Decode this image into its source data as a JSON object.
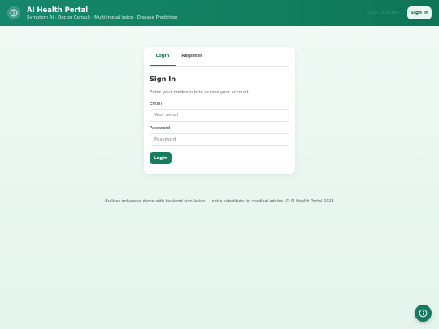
{
  "header": {
    "title": "AI Health Portal",
    "subtitle": "Symptom AI · Doctor Consult · Multilingual Voice · Disease Prediction",
    "ghost_link": "Sign in demo",
    "signin_label": "Sign In",
    "logo_icon": "info-icon"
  },
  "auth_card": {
    "tabs": [
      {
        "label": "Login",
        "active": true
      },
      {
        "label": "Register",
        "active": false
      }
    ],
    "heading": "Sign In",
    "description": "Enter your credentials to access your account",
    "email": {
      "label": "Email",
      "placeholder": "Your email",
      "value": ""
    },
    "password": {
      "label": "Password",
      "placeholder": "Password",
      "value": ""
    },
    "submit_label": "Login"
  },
  "footer": {
    "text": "Built as enhanced demo with backend simulation — not a substitute for medical advice. © AI Health Portal 2025"
  },
  "fab": {
    "icon": "info-icon"
  },
  "colors": {
    "brand": "#137a5d",
    "header_start": "#16876c",
    "background": "#eef8f3"
  }
}
